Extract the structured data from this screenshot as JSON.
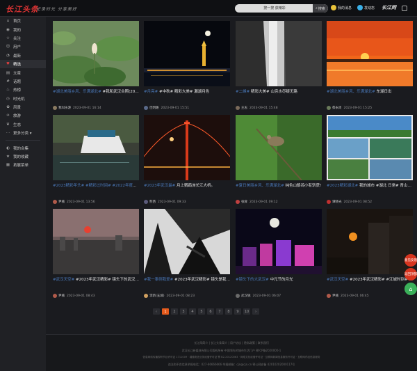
{
  "header": {
    "logo": "长江头条",
    "slogan": "记录时光 分享美好",
    "search_placeholder": "搜一搜 获精彩",
    "search_button": "搜索",
    "my_menu": "我的消息",
    "publish": "发动态",
    "brand": "长江网"
  },
  "sidebar": {
    "items": [
      {
        "icon": "⌂",
        "label": "首页",
        "name": "home"
      },
      {
        "icon": "◉",
        "label": "我的",
        "name": "mine"
      },
      {
        "icon": "☆",
        "label": "关注",
        "name": "follow"
      },
      {
        "icon": "☺",
        "label": "用户",
        "name": "users"
      },
      {
        "icon": "◔",
        "label": "最新",
        "name": "latest"
      },
      {
        "icon": "♥",
        "label": "精选",
        "name": "featured",
        "active": true
      },
      {
        "icon": "▤",
        "label": "文章",
        "name": "articles"
      },
      {
        "icon": "#",
        "label": "话题",
        "name": "topics"
      },
      {
        "icon": "♨",
        "label": "热榜",
        "name": "hot"
      },
      {
        "icon": "◷",
        "label": "时光机",
        "name": "time-machine"
      },
      {
        "icon": "✿",
        "label": "风景",
        "name": "scenery"
      },
      {
        "icon": "✈",
        "label": "旅游",
        "name": "travel"
      },
      {
        "icon": "❦",
        "label": "生态",
        "name": "ecology"
      },
      {
        "icon": "⋯",
        "label": "更多分类 ▾",
        "name": "more-categories"
      }
    ],
    "secondary": [
      {
        "icon": "◐",
        "label": "我的合集",
        "name": "my-collections"
      },
      {
        "icon": "★",
        "label": "我的收藏",
        "name": "my-favorites"
      },
      {
        "icon": "▦",
        "label": "拓展菜单",
        "name": "extended-menu"
      }
    ]
  },
  "cards": [
    {
      "tags": "#湖北美丽乡风、乐满湖北#",
      "title": "#湖北美丽乡风、乐满湖北# #我和武汉合照(2022年度)# 《等待》",
      "user": "我叫乐游",
      "date": "2023-09-01 16:14",
      "avatar": "#8a7a60"
    },
    {
      "tags": "#月亮#",
      "title": "#月亮# #中秋# 精彩大美# 漏湖月色",
      "user": "佳明路",
      "date": "2023-09-01 15:51",
      "avatar": "#5a6a8a"
    },
    {
      "tags": "#二峰#",
      "title": "#二峰# 精彩大美# 山穷水尽疑无路",
      "user": "王志",
      "date": "2023-09-01 15:48",
      "avatar": "#7a6a5a"
    },
    {
      "tags": "#湖北美丽乡风、乐满湖北#",
      "title": "#湖北美丽乡风、乐满湖北# 东湖日出",
      "user": "蔡永尚",
      "date": "2023-09-01 15:25",
      "avatar": "#6a7a5a"
    },
    {
      "tags": "#2023精彩年头# #精彩过时间# #2022年度武汉#",
      "title": "#2023精彩年头# #精彩过时间# #2022年度武汉# #精彩大美# #我们的城市# #有你的...",
      "user": "尹楠",
      "date": "2023-09-01 13:56",
      "avatar": "#b05a4a"
    },
    {
      "tags": "#2023年武汉最#",
      "title": "#2023年武汉最# 月上鹦鹉洲长江大桥。",
      "user": "熊西",
      "date": "2023-09-01 09:33",
      "avatar": "#5a5a7a"
    },
    {
      "tags": "#夏日美丽乡风、乐满湖北#",
      "title": "#夏日美丽乡风、乐满湖北# 纯色山鹡鸰小有斩获!",
      "user": "张舜",
      "date": "2023-09-01 09:12",
      "avatar": "#c04040"
    },
    {
      "tags": "#2023精彩湖北#",
      "title": "#2023精彩湖北# 我的城市 #湖北 日常# 青山就是美丽蓝天就是幸福 (拒霾蜱地点:...",
      "user": "谭晓光",
      "date": "2023-09-01 08:52",
      "avatar": "#c03030"
    },
    {
      "tags": "#武汉天空#",
      "title": "#武汉天空# #2023年武汉精彩# 镜头下的武汉天空# #我的武汉# #精彩瞬间#",
      "user": "尹楠",
      "date": "2023-09-01 08:43",
      "avatar": "#b05a4a"
    },
    {
      "tags": "#我一事例我爱#",
      "title": "#我一事例我爱# #2023年武汉精彩# 镜头是我打开世界的方式# #我们的城市# #我的武汉...",
      "user": "李新(五城)",
      "date": "2023-09-01 08:23",
      "avatar": "#d0a060"
    },
    {
      "tags": "#镜头下的大武汉#",
      "title": "#镜头下的大武汉# 中元节的月光",
      "user": "武汉锐",
      "date": "2023-09-01 06:07",
      "avatar": "#6a6a6a"
    },
    {
      "tags": "#武汉天空#",
      "title": "#武汉天空# #2023年武汉精彩# #江城时刻# 在家",
      "user": "尹楠",
      "date": "2023-09-01 06:45",
      "avatar": "#b05a4a"
    }
  ],
  "pagination": {
    "prev": "‹",
    "pages": [
      "1",
      "2",
      "3",
      "4",
      "5",
      "6",
      "7",
      "8",
      "9",
      "10"
    ],
    "next": "›",
    "active": "1"
  },
  "footer": {
    "links": "长江网简介 | 长江头条简介 | 用户协议 | 隐私政策 | 联系我们",
    "line1": "武汉长江新媒体有限公司版权所有·中国领先的城市生活门户 鄂ICP备2020000-1",
    "line2": "信息网络传播视听节目许可证 1711009 · 增值电信业务经营许可证 鄂 B2-20120063 · 网络文化经营许可证 · 互联网新闻信息服务许可证 · 互联网药品信息服务",
    "line3": "违法和不良信息举报电话：027-66666666  举报邮箱：cjn@cjn.cn  鄂公网安备 42010202000117号"
  },
  "float_buttons": {
    "feedback": "意见反馈",
    "top": "返回顶部",
    "home": "主页"
  },
  "colors": {
    "accent": "#e45a1c",
    "logo": "#e03434",
    "tag": "#4a78b8"
  }
}
